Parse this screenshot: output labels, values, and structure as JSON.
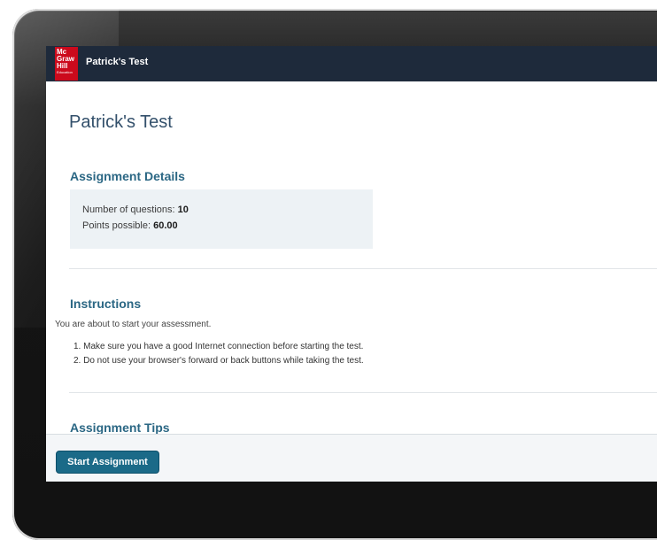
{
  "header": {
    "logo": {
      "line1": "Mc",
      "line2": "Graw",
      "line3": "Hill",
      "line4": "Education"
    },
    "title": "Patrick's Test"
  },
  "main": {
    "page_title": "Patrick's Test",
    "assignment_details": {
      "heading": "Assignment Details",
      "questions_label": "Number of questions:",
      "questions_value": "10",
      "points_label": "Points possible:",
      "points_value": "60.00"
    },
    "instructions": {
      "heading": "Instructions",
      "lead": "You are about to start your assessment.",
      "items": [
        "1. Make sure you have a good Internet connection before starting the test.",
        "2. Do not use your browser's forward or back buttons while taking the test."
      ]
    },
    "tips_heading": "Assignment Tips"
  },
  "footer": {
    "start_button": "Start Assignment"
  },
  "colors": {
    "topbar": "#1e2a3b",
    "brand_red": "#cc0a1c",
    "heading_blue": "#2b6784",
    "button": "#1b6a88"
  }
}
